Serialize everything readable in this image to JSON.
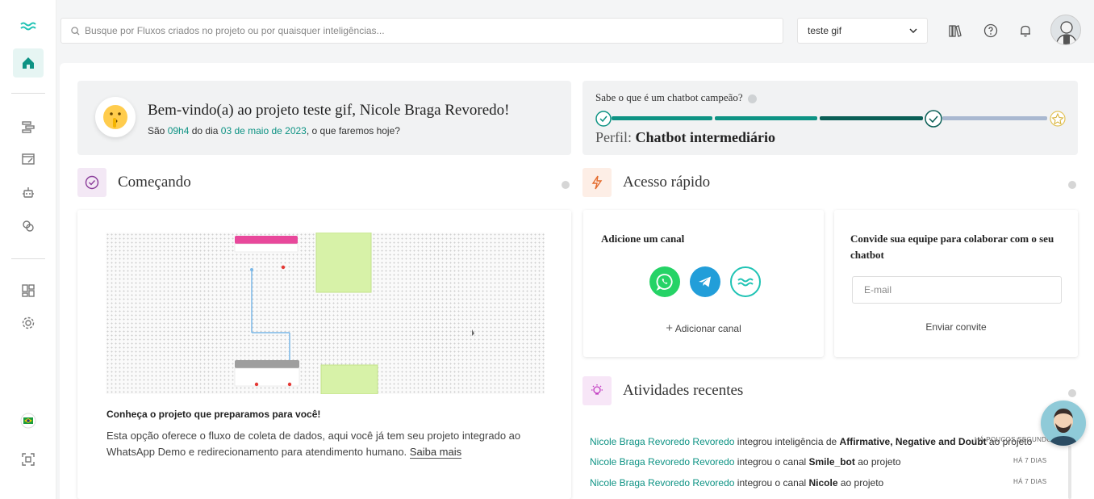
{
  "search": {
    "placeholder": "Busque por Fluxos criados no projeto ou por quaisquer inteligências..."
  },
  "project_select": {
    "value": "teste gif"
  },
  "welcome": {
    "title": "Bem-vindo(a) ao projeto teste gif, Nicole Braga Revoredo!",
    "sub_prefix": "São ",
    "time": "09h4",
    "sub_mid": " do dia ",
    "date": "03 de maio de 2023",
    "sub_suffix": ", o que faremos hoje?"
  },
  "champion": {
    "title": "Sabe o que é um chatbot campeão?",
    "profile_label": "Perfil:",
    "profile_value": "Chatbot intermediário"
  },
  "sections": {
    "starting": "Começando",
    "quick_access": "Acesso rápido",
    "recent": "Atividades recentes"
  },
  "starting_card": {
    "heading": "Conheça o projeto que preparamos para você!",
    "description": "Esta opção oferece o fluxo de coleta de dados, aqui você já tem seu projeto integrado ao WhatsApp Demo e redirecionamento para atendimento humano.",
    "link": "Saiba mais"
  },
  "channel_card": {
    "title": "Adicione um canal",
    "add_label": "Adicionar canal"
  },
  "invite_card": {
    "title": "Convide sua equipe para colaborar com o seu chatbot",
    "email_placeholder": "E-mail",
    "send_label": "Enviar convite"
  },
  "activities": [
    {
      "user": "Nicole Braga Revoredo Revoredo",
      "action": " integrou inteligência de ",
      "target": "Affirmative, Negative and Doubt",
      "suffix": " ao projeto",
      "time": "HÁ POUCOS SEGUNDOS"
    },
    {
      "user": "Nicole Braga Revoredo Revoredo",
      "action": " integrou o canal ",
      "target": "Smile_bot",
      "suffix": " ao projeto",
      "time": "HÁ 7 DIAS"
    },
    {
      "user": "Nicole Braga Revoredo Revoredo",
      "action": " integrou o canal ",
      "target": "Nicole",
      "suffix": " ao projeto",
      "time": "HÁ 7 DIAS"
    }
  ],
  "colors": {
    "accent": "#0e9384",
    "whatsapp": "#25d366",
    "telegram": "#229ed9",
    "blip": "#1fc3b4"
  }
}
